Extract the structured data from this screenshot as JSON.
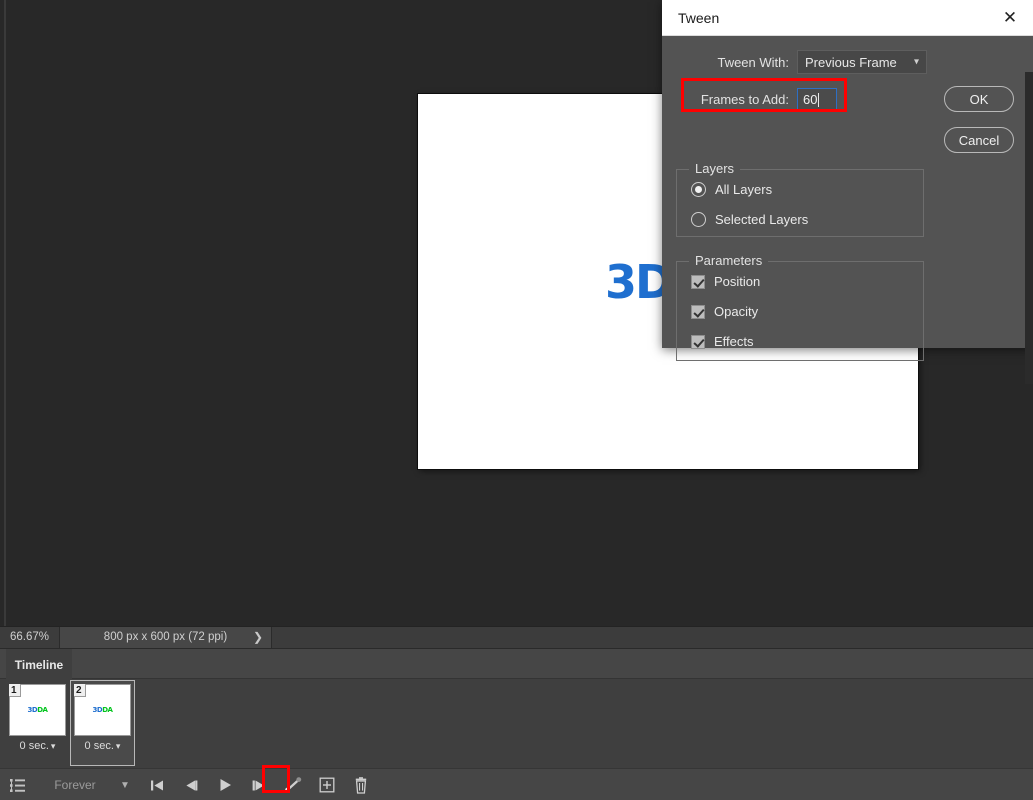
{
  "app": {
    "workspace_bg": "#282828",
    "accent_highlight": "#ff0000",
    "canvas_artwork": {
      "part1": "3",
      "part2": "D",
      "part3": "D",
      "part4": "A"
    }
  },
  "status_bar": {
    "zoom": "66.67%",
    "doc_size": "800 px x 600 px (72 ppi)",
    "chevron_icon": "chevron-right-icon"
  },
  "timeline": {
    "tab_label": "Timeline",
    "frames": [
      {
        "number": "1",
        "delay": "0 sec.",
        "caret": "⌄",
        "selected": false,
        "art_a": "3D",
        "art_b": "DA"
      },
      {
        "number": "2",
        "delay": "0 sec.",
        "caret": "⌄",
        "selected": true,
        "art_a": "3D",
        "art_b": "DA"
      }
    ],
    "toolbar": {
      "frame_view_icon": "frame-view-icon",
      "loop_label": "Forever",
      "loop_caret_icon": "triangle-down-icon",
      "first_frame_icon": "skip-to-first-icon",
      "prev_frame_icon": "step-backward-icon",
      "play_icon": "play-icon",
      "next_frame_icon": "step-forward-icon",
      "tween_icon": "tween-icon",
      "duplicate_icon": "duplicate-frame-icon",
      "delete_icon": "trash-icon"
    }
  },
  "dialog": {
    "title": "Tween",
    "close_icon": "close-icon",
    "tween_with": {
      "label": "Tween With:",
      "value": "Previous Frame",
      "caret_icon": "chevron-down-icon"
    },
    "frames_to_add": {
      "label": "Frames to Add:",
      "value": "60"
    },
    "buttons": {
      "ok": "OK",
      "cancel": "Cancel"
    },
    "layers_group": {
      "title": "Layers",
      "options": [
        {
          "label": "All Layers",
          "checked": true
        },
        {
          "label": "Selected Layers",
          "checked": false
        }
      ]
    },
    "parameters_group": {
      "title": "Parameters",
      "options": [
        {
          "label": "Position",
          "checked": true
        },
        {
          "label": "Opacity",
          "checked": true
        },
        {
          "label": "Effects",
          "checked": true
        }
      ]
    }
  }
}
